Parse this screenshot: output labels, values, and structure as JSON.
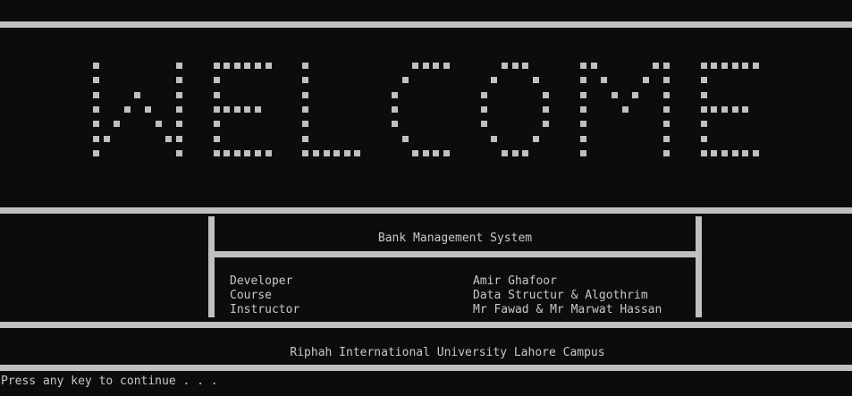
{
  "banner": {
    "word": "WELCOME"
  },
  "box": {
    "title": "Bank Management System",
    "rows": [
      {
        "label": "Developer",
        "value": "Amir Ghafoor"
      },
      {
        "label": "Course",
        "value": "Data Structur & Algothrim"
      },
      {
        "label": "Instructor",
        "value": "Mr Fawad & Mr Marwat Hassan"
      }
    ]
  },
  "footer": {
    "university": "Riphah International University Lahore Campus"
  },
  "prompt": {
    "text": "Press any key to continue . . ."
  },
  "colors": {
    "background": "#0c0c0c",
    "foreground": "#c0c0c0"
  }
}
